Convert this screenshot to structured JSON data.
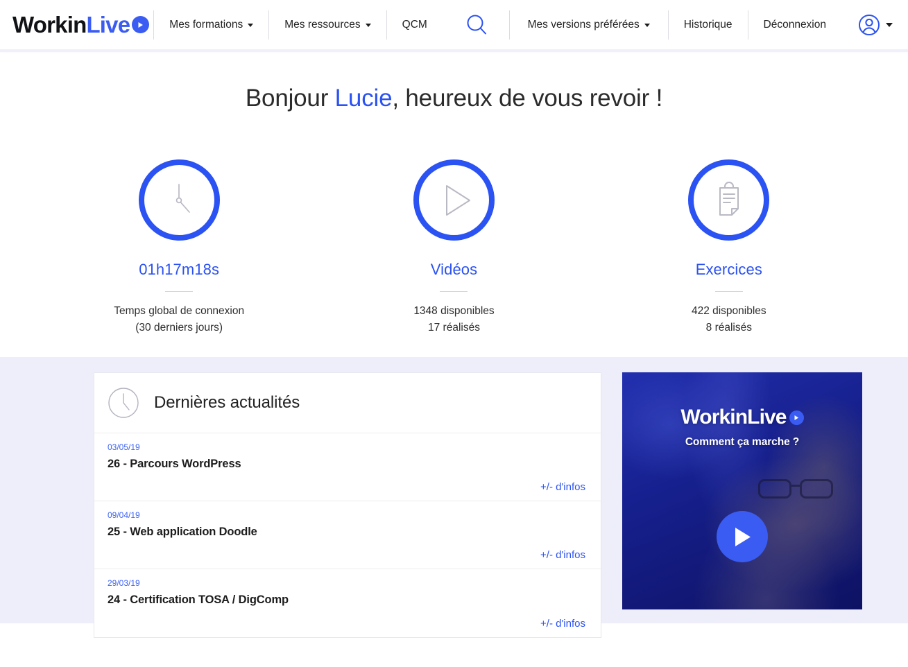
{
  "brand": {
    "text_dark": "Workin",
    "text_accent": "Live",
    "play_icon": "play-circle-icon"
  },
  "nav": {
    "items": [
      {
        "label": "Mes formations",
        "caret": true
      },
      {
        "label": "Mes ressources",
        "caret": true
      },
      {
        "label": "QCM",
        "caret": false
      },
      {
        "label": "Mes versions préférées",
        "caret": true
      },
      {
        "label": "Historique",
        "caret": false
      },
      {
        "label": "Déconnexion",
        "caret": false
      }
    ],
    "search_icon": "search-icon",
    "account_icon": "user-circle-icon"
  },
  "hero": {
    "greeting_prefix": "Bonjour ",
    "user_name": "Lucie",
    "greeting_suffix": ", heureux de vous revoir !"
  },
  "stats": [
    {
      "icon": "clock-icon",
      "value": "01h17m18s",
      "line1": "Temps global de connexion",
      "line2": "(30 derniers jours)"
    },
    {
      "icon": "play-icon",
      "value": "Vidéos",
      "line1": "1348 disponibles",
      "line2": "17 réalisés"
    },
    {
      "icon": "clipboard-icon",
      "value": "Exercices",
      "line1": "422 disponibles",
      "line2": "8 réalisés"
    }
  ],
  "news": {
    "icon": "clock-icon",
    "title": "Dernières actualités",
    "more_label": "+/- d'infos",
    "items": [
      {
        "date": "03/05/19",
        "title": "26 - Parcours WordPress"
      },
      {
        "date": "09/04/19",
        "title": "25 - Web application Doodle"
      },
      {
        "date": "29/03/19",
        "title": "24 - Certification TOSA / DigComp"
      }
    ]
  },
  "promo": {
    "logo_dark": "Workin",
    "logo_accent": "Live",
    "subtitle": "Comment ça marche ?",
    "play_icon": "play-button-icon"
  },
  "colors": {
    "accent": "#2b52f2",
    "logo_blue": "#3a5cf2",
    "lower_bg": "#eeeefa",
    "icon_gray": "#b9b9c4"
  }
}
